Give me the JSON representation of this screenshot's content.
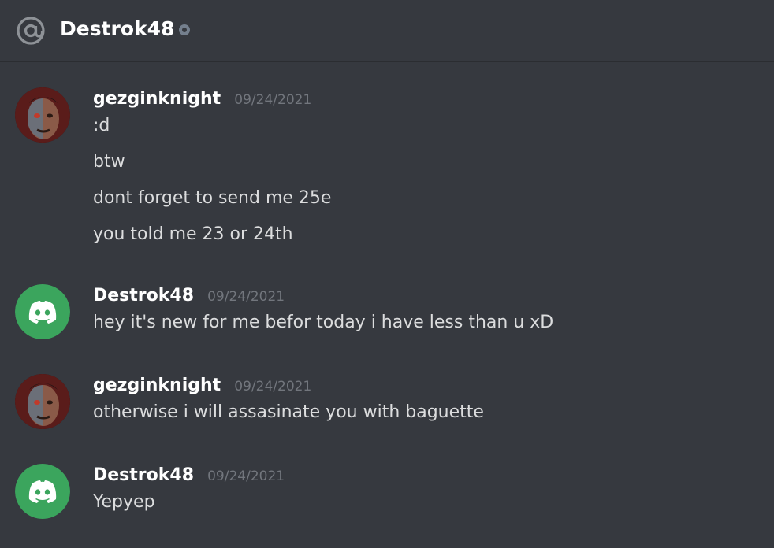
{
  "header": {
    "title": "Destrok48",
    "icon": "at-icon",
    "status_icon": "status-offline-icon"
  },
  "colors": {
    "background": "#36393f",
    "discord_green": "#3ba55d",
    "timestamp": "#72767d",
    "text": "#dcddde"
  },
  "messages": [
    {
      "author": "gezginknight",
      "timestamp": "09/24/2021",
      "avatar": "user-photo-avatar",
      "lines": [
        ":d",
        "btw",
        "dont forget to send me 25e",
        "you told me 23 or 24th"
      ]
    },
    {
      "author": "Destrok48",
      "timestamp": "09/24/2021",
      "avatar": "discord-default-avatar",
      "lines": [
        "hey it's new for me befor today i have less than u xD"
      ]
    },
    {
      "author": "gezginknight",
      "timestamp": "09/24/2021",
      "avatar": "user-photo-avatar",
      "lines": [
        "otherwise i will assasinate you with baguette"
      ]
    },
    {
      "author": "Destrok48",
      "timestamp": "09/24/2021",
      "avatar": "discord-default-avatar",
      "lines": [
        "Yepyep"
      ]
    }
  ]
}
